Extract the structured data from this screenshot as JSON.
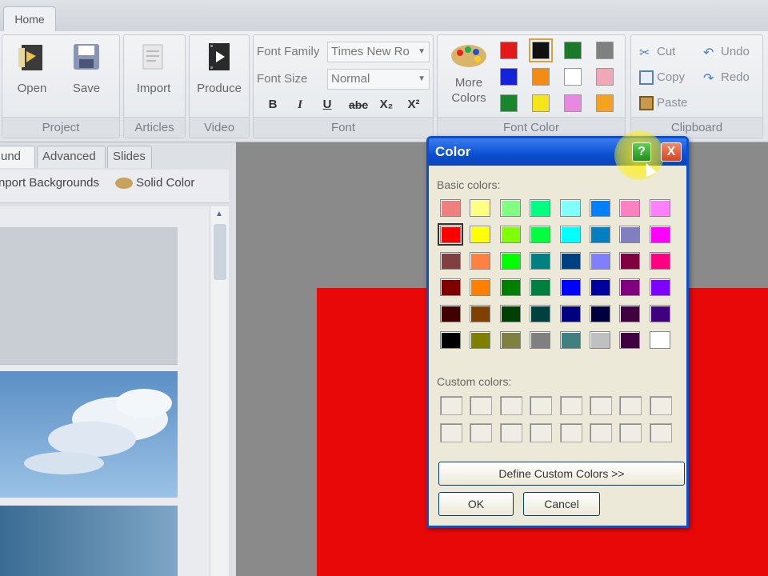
{
  "ribbon": {
    "tab": "Home",
    "project": {
      "label": "Project",
      "open": "Open",
      "save": "Save"
    },
    "articles": {
      "label": "Articles",
      "import": "Import"
    },
    "video": {
      "label": "Video",
      "produce": "Produce"
    },
    "font": {
      "label": "Font",
      "family_label": "Font Family",
      "family_value": "Times New Ro",
      "size_label": "Font Size",
      "size_value": "Normal",
      "bold": "B",
      "italic": "I",
      "underline": "U",
      "strike": "abc",
      "subscript": "X₂",
      "superscript": "X²"
    },
    "font_color": {
      "label": "Font Color",
      "more_colors": "More Colors",
      "swatches": [
        "#e51919",
        "#111111",
        "#1a7a2a",
        "#808080",
        "#1422d8",
        "#f28c14",
        "#ffffff",
        "#f0a8b8",
        "#18842c",
        "#f5e619",
        "#e888e0",
        "#f5a21e"
      ]
    },
    "clipboard": {
      "label": "Clipboard",
      "cut": "Cut",
      "copy": "Copy",
      "paste": "Paste",
      "undo": "Undo",
      "redo": "Redo"
    }
  },
  "left_panel": {
    "tabs": [
      "und",
      "Advanced",
      "Slides"
    ],
    "import_backgrounds": "nport Backgrounds",
    "solid_color": "Solid Color"
  },
  "dialog": {
    "title": "Color",
    "help": "?",
    "close": "X",
    "basic_colors_label": "Basic colors:",
    "basic_colors": [
      [
        "#f08080",
        "#ffff80",
        "#80ff80",
        "#00ff80",
        "#80ffff",
        "#0080ff",
        "#ff80c0",
        "#ff80ff"
      ],
      [
        "#ff0000",
        "#ffff00",
        "#80ff00",
        "#00ff40",
        "#00ffff",
        "#0080c0",
        "#8080c0",
        "#ff00ff"
      ],
      [
        "#804040",
        "#ff8040",
        "#00ff00",
        "#008080",
        "#004080",
        "#8080ff",
        "#800040",
        "#ff0080"
      ],
      [
        "#800000",
        "#ff8000",
        "#008000",
        "#008040",
        "#0000ff",
        "#0000a0",
        "#800080",
        "#8000ff"
      ],
      [
        "#400000",
        "#804000",
        "#004000",
        "#004040",
        "#000080",
        "#000040",
        "#400040",
        "#400080"
      ],
      [
        "#000000",
        "#808000",
        "#808040",
        "#808080",
        "#408080",
        "#c0c0c0",
        "#400040",
        "#ffffff"
      ]
    ],
    "custom_colors_label": "Custom colors:",
    "define_custom": "Define Custom Colors >>",
    "ok": "OK",
    "cancel": "Cancel"
  },
  "canvas_color": "#e80808"
}
